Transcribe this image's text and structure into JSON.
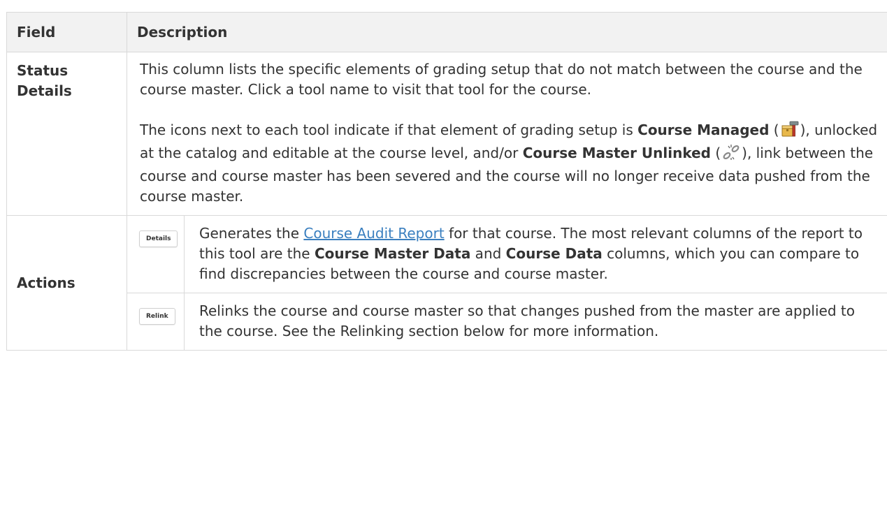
{
  "table": {
    "headers": {
      "field": "Field",
      "description": "Description"
    },
    "rows": {
      "status_details": {
        "field": "Status Details",
        "para1": "This column lists the specific elements of grading setup that do not match between the course and the course master. Click a tool name to visit that tool for the course.",
        "para2": {
          "t1": "The icons next to each tool indicate if that element of grading setup is ",
          "b1": "Course Managed",
          "t2": " (",
          "t3": "), unlocked at the catalog and editable at the course level, and/or ",
          "b2": "Course Master Unlinked",
          "t4": " (",
          "t5": "), link between the course and course master has been severed and the course will no longer receive data pushed from the course master."
        },
        "icons": {
          "course_managed": "hammer-toolbox-icon",
          "unlinked": "broken-chain-icon"
        }
      },
      "actions": {
        "field": "Actions",
        "details": {
          "button_label": "Details",
          "t1": "Generates the ",
          "link": "Course Audit Report",
          "t2": " for that course. The most relevant columns of the report to this tool are the ",
          "b1": "Course Master Data",
          "t3": " and ",
          "b2": "Course Data",
          "t4": " columns, which you can compare to find discrepancies between the course and course master."
        },
        "relink": {
          "button_label": "Relink",
          "text": "Relinks the course and course master so that changes pushed from the master are applied to the course. See the Relinking section below for more information."
        }
      }
    }
  },
  "colors": {
    "link": "#3a7fbf",
    "header_bg": "#f2f2f2",
    "border": "#d9d9d9",
    "text": "#333333"
  }
}
